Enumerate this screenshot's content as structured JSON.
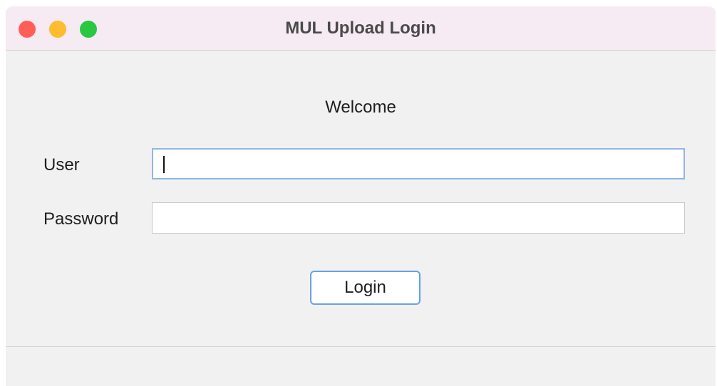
{
  "window": {
    "title": "MUL Upload Login",
    "traffic_lights": {
      "close": "#ff5f57",
      "minimize": "#febc2e",
      "zoom": "#28c840"
    }
  },
  "form": {
    "welcome": "Welcome",
    "user_label": "User",
    "user_value": "",
    "password_label": "Password",
    "password_value": "",
    "login_button": "Login"
  },
  "colors": {
    "focus_ring": "#8fb6e7",
    "button_border": "#6aa0e4"
  }
}
